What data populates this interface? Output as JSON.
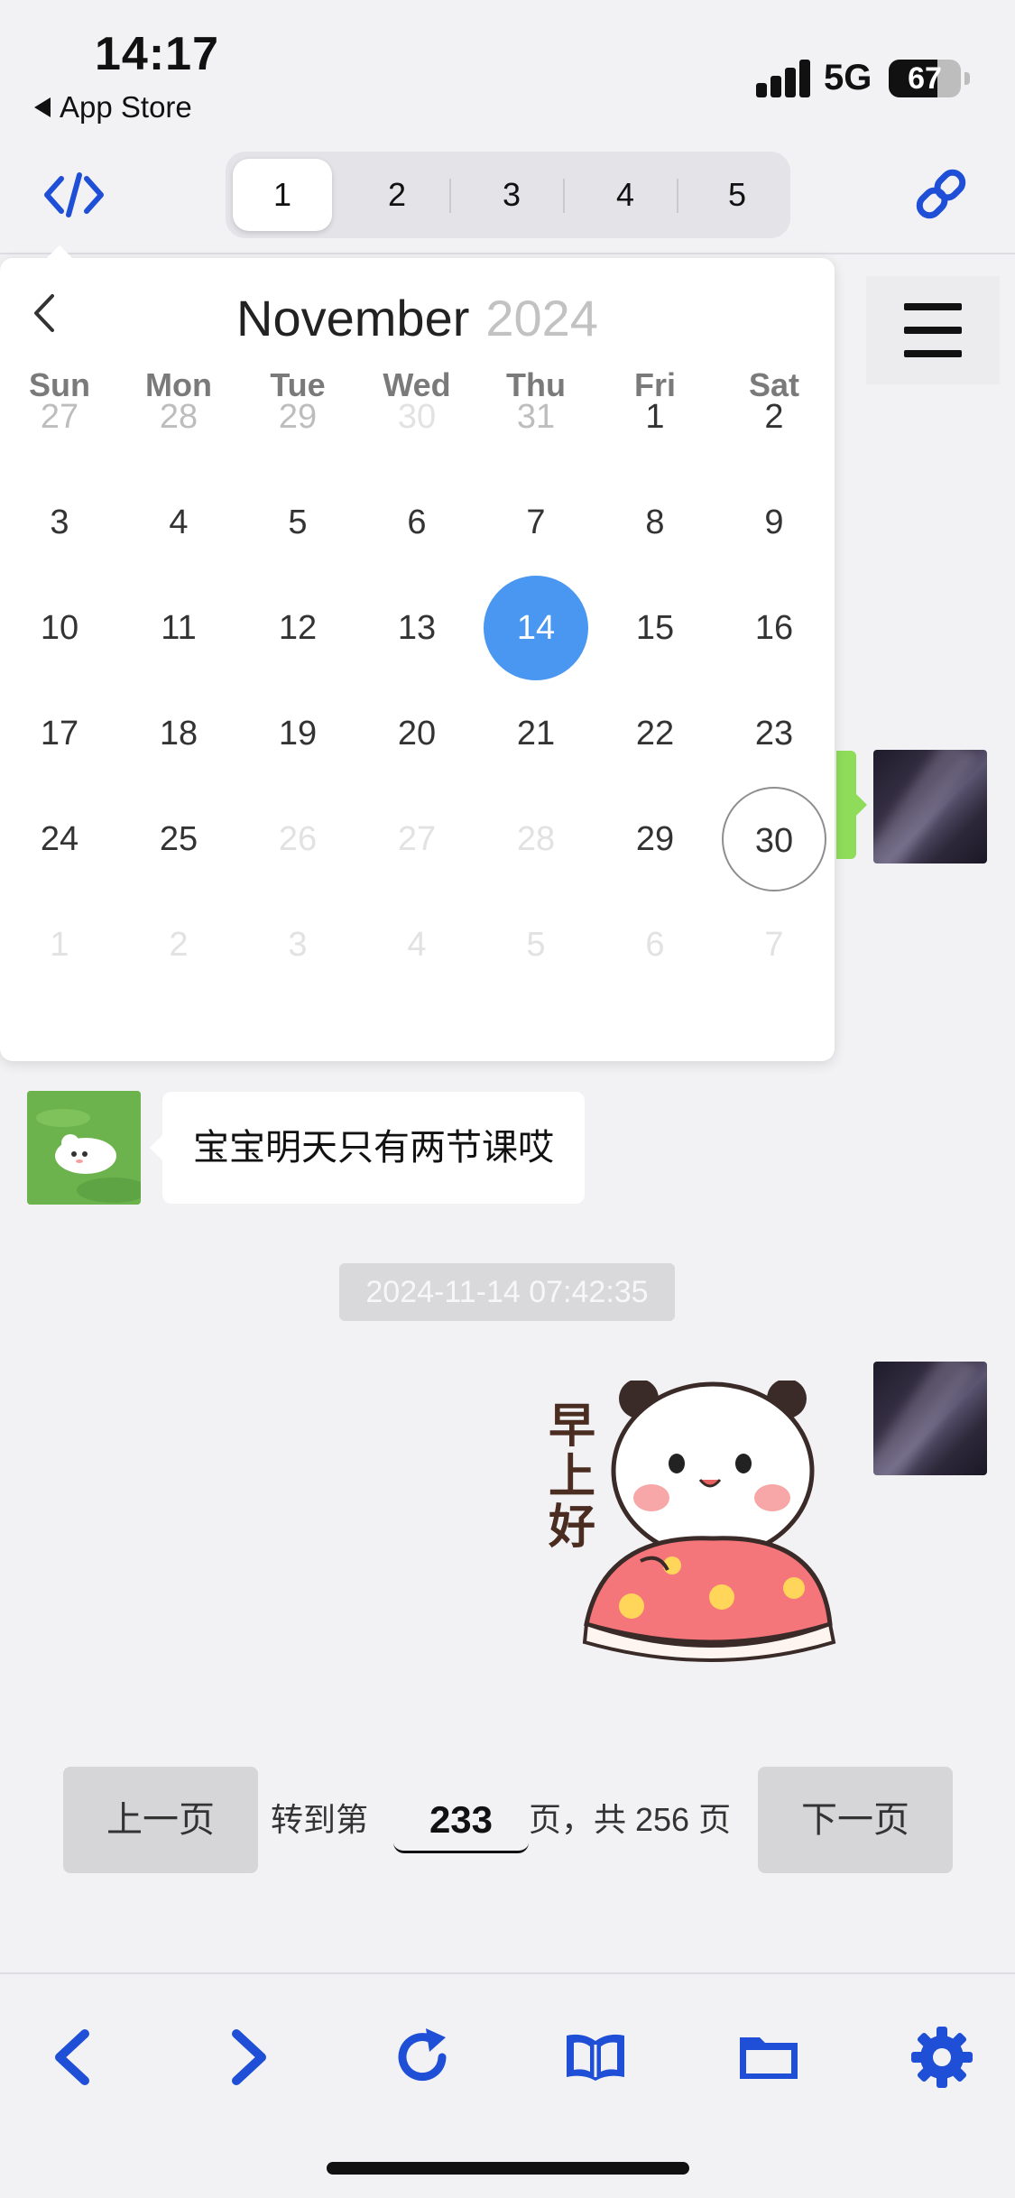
{
  "status_bar": {
    "time": "14:17",
    "back_label": "App Store",
    "network": "5G",
    "battery_level": "67",
    "battery_fraction": 0.67
  },
  "top_toolbar": {
    "left_icon": "code-icon",
    "right_icon": "link-icon",
    "tabs": [
      "1",
      "2",
      "3",
      "4",
      "5"
    ],
    "active_tab": "1",
    "accent_color": "#1e4fd6"
  },
  "calendar": {
    "month": "November",
    "year": "2024",
    "prev_icon": "chevron-left-icon",
    "weekdays": [
      "Sun",
      "Mon",
      "Tue",
      "Wed",
      "Thu",
      "Fri",
      "Sat"
    ],
    "weeks": [
      [
        {
          "d": "27",
          "s": "other"
        },
        {
          "d": "28",
          "s": "other"
        },
        {
          "d": "29",
          "s": "other"
        },
        {
          "d": "30",
          "s": "disabled"
        },
        {
          "d": "31",
          "s": "other"
        },
        {
          "d": "1",
          "s": ""
        },
        {
          "d": "2",
          "s": ""
        }
      ],
      [
        {
          "d": "3",
          "s": ""
        },
        {
          "d": "4",
          "s": ""
        },
        {
          "d": "5",
          "s": ""
        },
        {
          "d": "6",
          "s": ""
        },
        {
          "d": "7",
          "s": ""
        },
        {
          "d": "8",
          "s": ""
        },
        {
          "d": "9",
          "s": ""
        }
      ],
      [
        {
          "d": "10",
          "s": ""
        },
        {
          "d": "11",
          "s": ""
        },
        {
          "d": "12",
          "s": ""
        },
        {
          "d": "13",
          "s": ""
        },
        {
          "d": "14",
          "s": "selected"
        },
        {
          "d": "15",
          "s": ""
        },
        {
          "d": "16",
          "s": ""
        }
      ],
      [
        {
          "d": "17",
          "s": ""
        },
        {
          "d": "18",
          "s": ""
        },
        {
          "d": "19",
          "s": ""
        },
        {
          "d": "20",
          "s": ""
        },
        {
          "d": "21",
          "s": ""
        },
        {
          "d": "22",
          "s": ""
        },
        {
          "d": "23",
          "s": ""
        }
      ],
      [
        {
          "d": "24",
          "s": ""
        },
        {
          "d": "25",
          "s": ""
        },
        {
          "d": "26",
          "s": "disabled"
        },
        {
          "d": "27",
          "s": "disabled"
        },
        {
          "d": "28",
          "s": "disabled"
        },
        {
          "d": "29",
          "s": ""
        },
        {
          "d": "30",
          "s": "today"
        }
      ],
      [
        {
          "d": "1",
          "s": "disabled"
        },
        {
          "d": "2",
          "s": "disabled"
        },
        {
          "d": "3",
          "s": "disabled"
        },
        {
          "d": "4",
          "s": "disabled"
        },
        {
          "d": "5",
          "s": "disabled"
        },
        {
          "d": "6",
          "s": "disabled"
        },
        {
          "d": "7",
          "s": "disabled"
        }
      ]
    ],
    "selected_color": "#4a97f1"
  },
  "chat": {
    "menu_icon": "hamburger-menu-icon",
    "message_text": "宝宝明天只有两节课哎",
    "timestamp": "2024-11-14 07:42:35",
    "sticker_text": "早上好"
  },
  "pager": {
    "prev_label": "上一页",
    "goto_prefix": "转到第",
    "current_page": "233",
    "goto_suffix": "页，共 256 页",
    "next_label": "下一页"
  },
  "bottom_toolbar": {
    "icons": [
      "back-icon",
      "forward-icon",
      "refresh-icon",
      "book-icon",
      "folder-icon",
      "settings-icon"
    ]
  }
}
